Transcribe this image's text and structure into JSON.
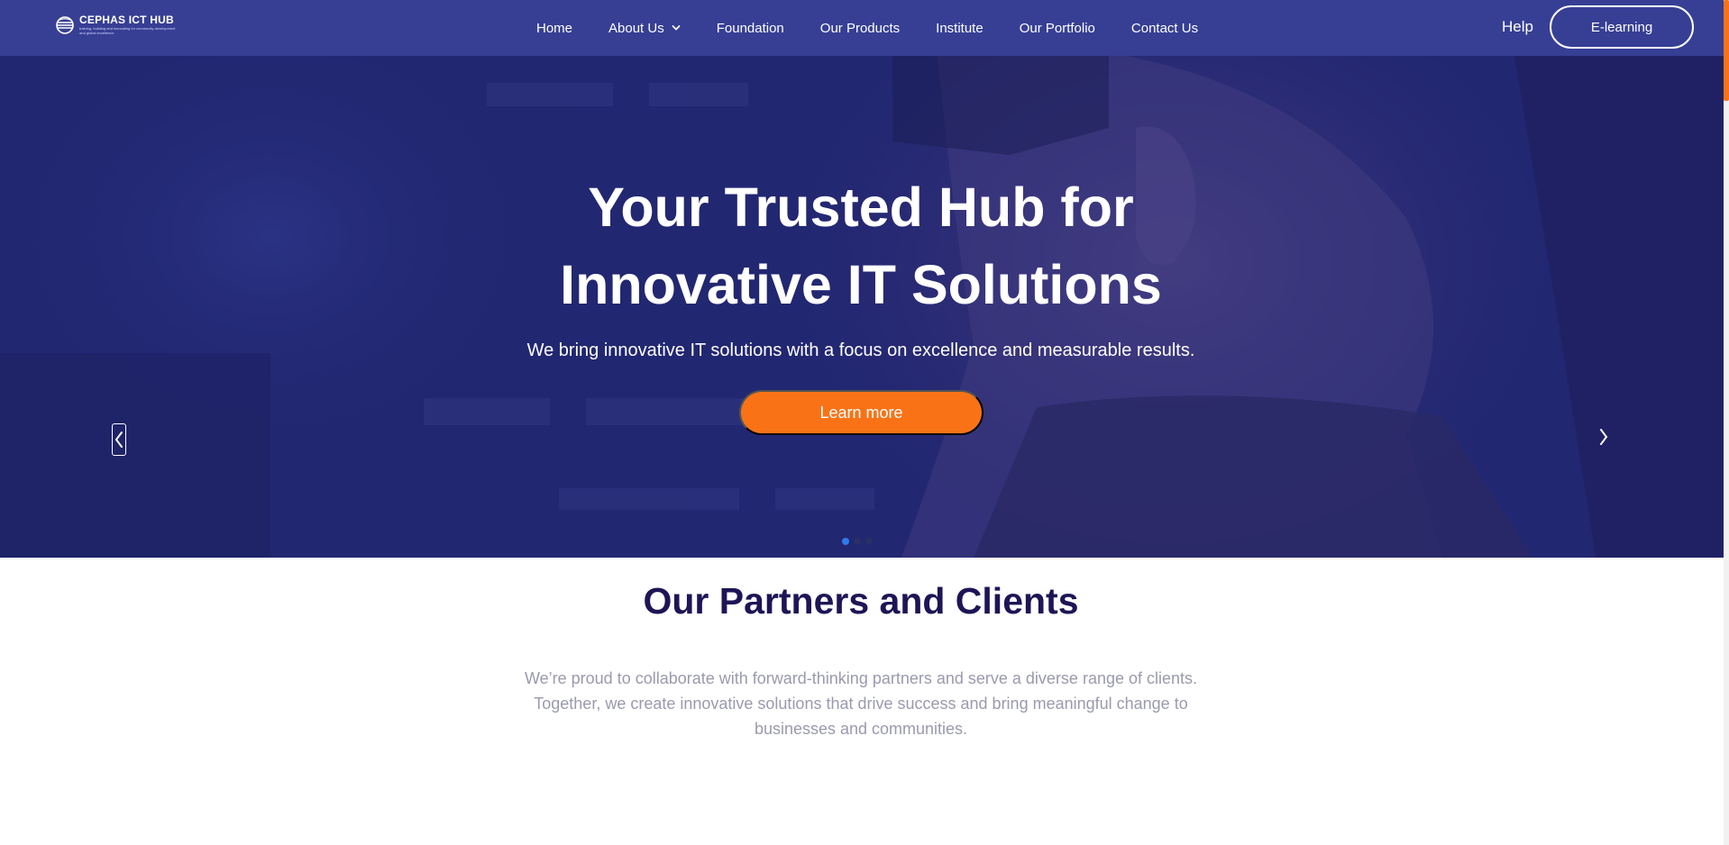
{
  "brand": {
    "name": "CEPHAS ICT HUB",
    "tagline": "training, building and innovating for community development and global excellence"
  },
  "nav": {
    "items": [
      {
        "label": "Home"
      },
      {
        "label": "About Us"
      },
      {
        "label": "Foundation"
      },
      {
        "label": "Our Products"
      },
      {
        "label": "Institute"
      },
      {
        "label": "Our Portfolio"
      },
      {
        "label": "Contact Us"
      }
    ],
    "help": "Help",
    "elearning": "E-learning"
  },
  "hero": {
    "title_line1": "Your Trusted Hub for",
    "title_line2": "Innovative IT Solutions",
    "subtitle": "We bring innovative IT solutions with a focus on excellence and measurable results.",
    "cta": "Learn more",
    "slide_count": 3,
    "active_slide": 1
  },
  "partners": {
    "title": "Our Partners and Clients",
    "line1": "We’re proud to collaborate with forward-thinking partners and serve a diverse range of clients.",
    "line2": "Together, we create innovative solutions that drive success and bring meaningful change to",
    "line3": "businesses and communities."
  },
  "colors": {
    "navbar": "#363f94",
    "accent": "#f97316",
    "heading": "#1e1556",
    "body_text": "#9a9aae",
    "active_dot": "#2f7be8"
  }
}
